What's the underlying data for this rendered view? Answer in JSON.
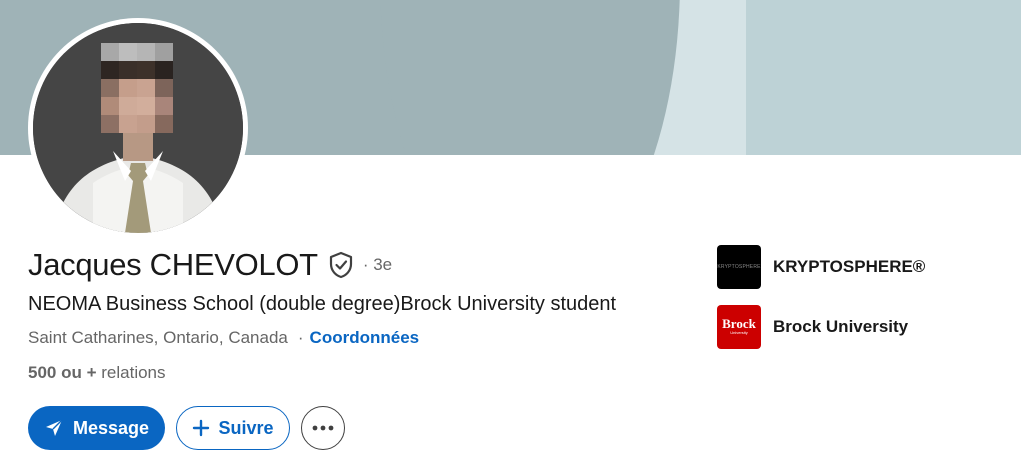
{
  "profile": {
    "name": "Jacques CHEVOLOT",
    "degree": "· 3e",
    "headline": "NEOMA Business School (double degree)Brock University student",
    "location": "Saint Catharines, Ontario, Canada",
    "separator": "·",
    "contact_label": "Coordonnées",
    "relations_count": "500 ou +",
    "relations_label": "relations"
  },
  "actions": {
    "message_label": "Message",
    "follow_label": "Suivre"
  },
  "sidebar": {
    "items": [
      {
        "label": "KRYPTOSPHERE®",
        "logo_text": "KRYPTOSPHERE"
      },
      {
        "label": "Brock University",
        "logo_text": "Brock",
        "logo_subtext": "University"
      }
    ]
  },
  "colors": {
    "accent": "#0a66c2",
    "banner": "#9fb3b7",
    "brock_red": "#cc0000"
  },
  "icons": {
    "verified": "shield-check-icon",
    "send": "send-icon",
    "plus": "plus-icon",
    "more": "more-horizontal-icon"
  }
}
